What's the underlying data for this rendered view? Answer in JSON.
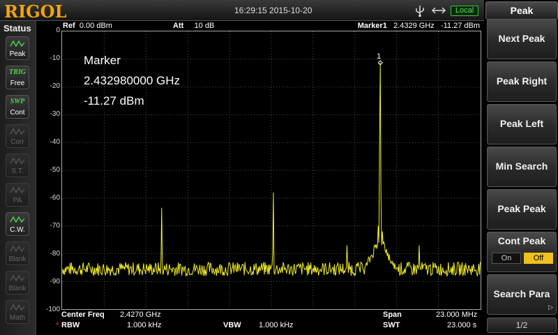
{
  "brand": "RIGOL",
  "datetime": "16:29:15 2015-10-20",
  "remote_status": "Local",
  "status_panel": {
    "title": "Status",
    "items": [
      {
        "name": "peak",
        "label": "Peak",
        "glyph": "/\\/\\",
        "active": true
      },
      {
        "name": "trig",
        "label": "Free",
        "glyph": "TRIG",
        "active": true
      },
      {
        "name": "swp",
        "label": "Cont",
        "glyph": "SWP",
        "active": true
      },
      {
        "name": "corr",
        "label": "Corr",
        "glyph": "~",
        "active": false
      },
      {
        "name": "st",
        "label": "S.T.",
        "glyph": "~",
        "active": false
      },
      {
        "name": "pa",
        "label": "PA",
        "glyph": "~",
        "active": false
      },
      {
        "name": "cw",
        "label": "C.W.",
        "glyph": "/\\/\\",
        "active": true
      },
      {
        "name": "blank1",
        "label": "Blank",
        "glyph": "~",
        "active": false
      },
      {
        "name": "blank2",
        "label": "Blank",
        "glyph": "~",
        "active": false
      },
      {
        "name": "math",
        "label": "Math",
        "glyph": "~",
        "active": false
      }
    ]
  },
  "header": {
    "ref_label": "Ref",
    "ref_value": "0.00 dBm",
    "att_label": "Att",
    "att_value": "10 dB",
    "marker_label": "Marker1",
    "marker_freq": "2.4329 GHz",
    "marker_amp": "-11.27 dBm"
  },
  "marker_readout": {
    "title": "Marker",
    "frequency": "2.432980000 GHz",
    "amplitude": "-11.27 dBm",
    "marker_number": "1"
  },
  "y_axis_labels": [
    "0",
    "-10",
    "-20",
    "-30",
    "-40",
    "-50",
    "-60",
    "-70",
    "-80",
    "-90",
    "-100"
  ],
  "footer": {
    "center_label": "Center Freq",
    "center_value": "2.4270 GHz",
    "span_label": "Span",
    "span_value": "23.000 MHz",
    "rbw_star": "*",
    "rbw_label": "RBW",
    "rbw_value": "1.000 kHz",
    "vbw_label": "VBW",
    "vbw_value": "1.000 kHz",
    "swt_label": "SWT",
    "swt_value": "23.000 s"
  },
  "menu": {
    "title": "Peak",
    "keys": [
      "Next Peak",
      "Peak Right",
      "Peak Left",
      "Min Search",
      "Peak Peak"
    ],
    "cont_peak": {
      "label": "Cont Peak",
      "on": "On",
      "off": "Off",
      "state": "Off"
    },
    "search_para": "Search Para",
    "page": "1/2"
  },
  "colors": {
    "trace": "#f4f02a",
    "grid": "#5a5a5a",
    "brand": "#f2a40a",
    "accent_green": "#3ec23e",
    "toggle_active": "#f0c020"
  },
  "trace": {
    "y_ref_dbm": 0,
    "db_per_div": 10,
    "noise_floor_dbm": -85.5,
    "peaks": [
      {
        "freq_ghz": 2.42096,
        "amp_dbm": -63.5
      },
      {
        "freq_ghz": 2.42711,
        "amp_dbm": -58
      },
      {
        "freq_ghz": 2.43116,
        "amp_dbm": -77
      },
      {
        "freq_ghz": 2.43298,
        "amp_dbm": -11.27
      },
      {
        "freq_ghz": 2.43513,
        "amp_dbm": -77
      }
    ]
  }
}
